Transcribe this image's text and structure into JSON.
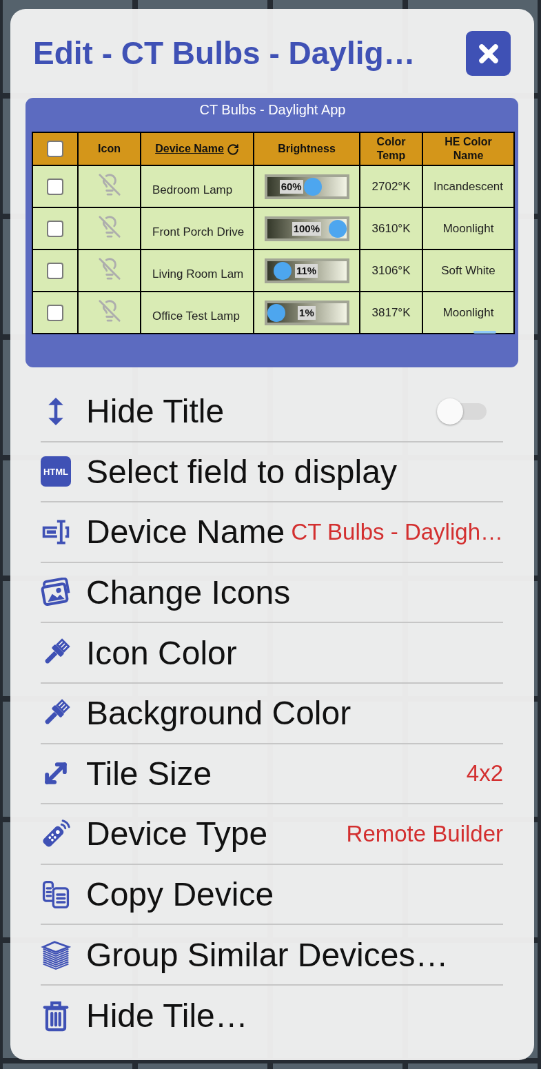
{
  "dialog": {
    "title": "Edit - CT Bulbs - Daylig…"
  },
  "preview": {
    "title": "CT Bulbs - Daylight App",
    "columns": [
      {
        "kind": "checkbox",
        "checked": false
      },
      {
        "kind": "text",
        "label": "Icon"
      },
      {
        "kind": "sort",
        "label": "Device Name"
      },
      {
        "kind": "text",
        "label": "Brightness"
      },
      {
        "kind": "text",
        "label": "Color Temp"
      },
      {
        "kind": "text",
        "label": "HE Color Name"
      }
    ],
    "rows": [
      {
        "checked": false,
        "name": "Bedroom Lamp",
        "level": 0.6,
        "reading": "60%",
        "color_temp": "2702°K",
        "color_name": "Incandescent"
      },
      {
        "checked": false,
        "name": "Front Porch Drive",
        "level": 1,
        "reading": "100%",
        "color_temp": "3610°K",
        "color_name": "Moonlight"
      },
      {
        "checked": false,
        "name": "Living Room Lam",
        "level": 0.11,
        "reading": "11%",
        "color_temp": "3106°K",
        "color_name": "Soft White"
      },
      {
        "checked": false,
        "name": "Office Test Lamp",
        "level": 0.01,
        "reading": "1%",
        "color_temp": "3817°K",
        "color_name": "Moonlight"
      }
    ]
  },
  "menu": [
    {
      "kind": "toggle",
      "label": "Hide Title",
      "on": false
    },
    {
      "kind": "badge",
      "label": "Select field to display",
      "badge": "HTML"
    },
    {
      "kind": "value",
      "label": "Device Name",
      "value": "CT Bulbs - Dayligh…"
    },
    {
      "kind": "plain",
      "label": "Change Icons"
    },
    {
      "kind": "plain",
      "label": "Icon Color"
    },
    {
      "kind": "plain",
      "label": "Background Color"
    },
    {
      "kind": "value",
      "label": "Tile Size",
      "value": "4x2"
    },
    {
      "kind": "value",
      "label": "Device Type",
      "value": "Remote Builder"
    },
    {
      "kind": "plain",
      "label": "Copy Device"
    },
    {
      "kind": "plain",
      "label": "Group Similar Devices…"
    },
    {
      "kind": "plain",
      "label": "Hide Tile…"
    }
  ]
}
